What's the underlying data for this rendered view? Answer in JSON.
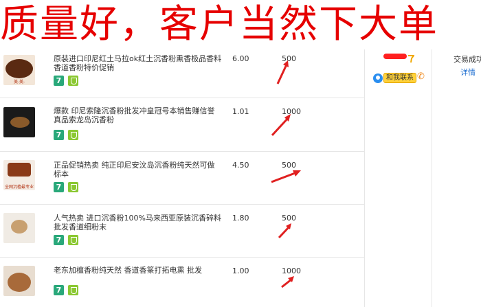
{
  "banner": {
    "text": "质量好，客户当然下大单"
  },
  "colors": {
    "banner": "#e60000",
    "arrow": "#e02020",
    "link": "#1f6fd0"
  },
  "rows": [
    {
      "title": "原装进口印尼红土马拉ok红土沉香粉熏香极品香料香道香粉特价促销",
      "price": "6.00",
      "qty": "500",
      "thumb_caption": "美-美-"
    },
    {
      "title": "爆款 印尼索隆沉香粉批发冲皇冠号本销售赚信誉真品索龙岛沉香粉",
      "price": "1.01",
      "qty": "1000",
      "thumb_caption": ""
    },
    {
      "title": "正品促销热卖 纯正印尼安汶岛沉香粉纯天然可做标本",
      "price": "4.50",
      "qty": "500",
      "thumb_caption": "全网沉檀最专业"
    },
    {
      "title": "人气热卖 进口沉香粉100%马来西亚原装沉香碎料批发香道细粉末",
      "price": "1.80",
      "qty": "500",
      "thumb_caption": ""
    },
    {
      "title": "老东加檀香粉纯天然 香道香篆打拓电熏 批发",
      "price": "1.00",
      "qty": "1000",
      "thumb_caption": ""
    }
  ],
  "seller": {
    "contact_label": "和我联系",
    "icon": "phone-icon"
  },
  "trade": {
    "status_label": "交易成功",
    "detail_link": "详情"
  }
}
